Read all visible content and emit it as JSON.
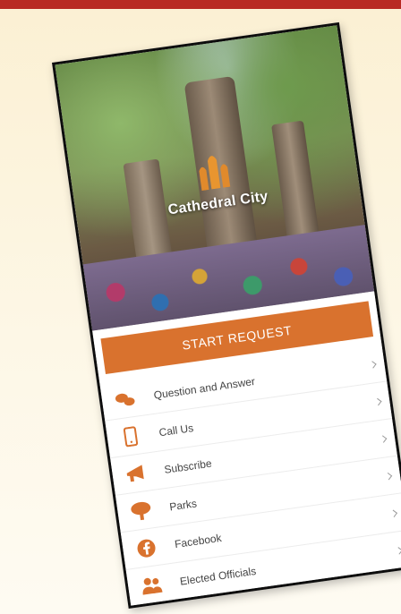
{
  "app": {
    "name": "Cathedral City"
  },
  "colors": {
    "accent": "#d9722e",
    "top_band": "#b82a23",
    "background": "#fbf0d3"
  },
  "start_button": {
    "label": "START REQUEST"
  },
  "menu": {
    "items": [
      {
        "label": "Question and Answer",
        "icon": "chat-bubbles-icon"
      },
      {
        "label": "Call Us",
        "icon": "phone-icon"
      },
      {
        "label": "Subscribe",
        "icon": "megaphone-icon"
      },
      {
        "label": "Parks",
        "icon": "tree-icon"
      },
      {
        "label": "Facebook",
        "icon": "facebook-icon"
      },
      {
        "label": "Elected Officials",
        "icon": "people-icon"
      }
    ]
  }
}
